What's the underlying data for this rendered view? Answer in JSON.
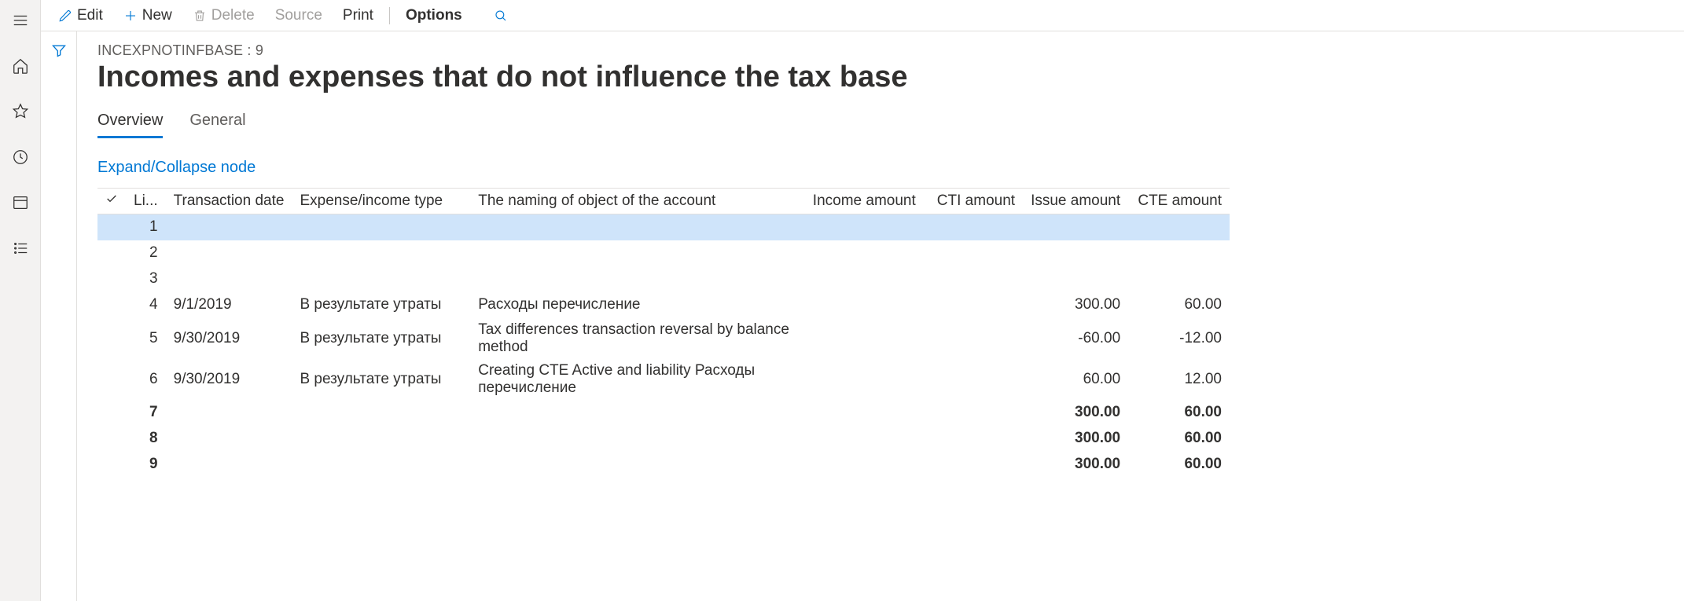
{
  "toolbar": {
    "edit": "Edit",
    "new": "New",
    "delete": "Delete",
    "source": "Source",
    "print": "Print",
    "options": "Options"
  },
  "page": {
    "subhead": "INCEXPNOTINFBASE : 9",
    "title": "Incomes and expenses that do not influence the tax base"
  },
  "tabs": {
    "overview": "Overview",
    "general": "General"
  },
  "links": {
    "expand": "Expand/Collapse node"
  },
  "grid": {
    "headers": {
      "line": "Li...",
      "date": "Transaction date",
      "type": "Expense/income type",
      "object": "The naming of object of the account",
      "income": "Income amount",
      "cti": "CTI amount",
      "issue": "Issue amount",
      "cte": "CTE amount"
    },
    "rows": [
      {
        "line": "1",
        "date": "",
        "type": "",
        "object": "",
        "income": "",
        "cti": "",
        "issue": "",
        "cte": "",
        "selected": true
      },
      {
        "line": "2",
        "date": "",
        "type": "",
        "object": "",
        "income": "",
        "cti": "",
        "issue": "",
        "cte": ""
      },
      {
        "line": "3",
        "date": "",
        "type": "",
        "object": "",
        "income": "",
        "cti": "",
        "issue": "",
        "cte": ""
      },
      {
        "line": "4",
        "date": "9/1/2019",
        "type": "В результате утраты",
        "object": "Расходы перечисление",
        "income": "",
        "cti": "",
        "issue": "300.00",
        "cte": "60.00"
      },
      {
        "line": "5",
        "date": "9/30/2019",
        "type": "В результате утраты",
        "object": "Tax differences transaction reversal by balance method",
        "income": "",
        "cti": "",
        "issue": "-60.00",
        "cte": "-12.00"
      },
      {
        "line": "6",
        "date": "9/30/2019",
        "type": "В результате утраты",
        "object": "Creating CTE Active and liability Расходы перечисление",
        "income": "",
        "cti": "",
        "issue": "60.00",
        "cte": "12.00"
      },
      {
        "line": "7",
        "date": "",
        "type": "",
        "object": "",
        "income": "",
        "cti": "",
        "issue": "300.00",
        "cte": "60.00",
        "totals": true
      },
      {
        "line": "8",
        "date": "",
        "type": "",
        "object": "",
        "income": "",
        "cti": "",
        "issue": "300.00",
        "cte": "60.00",
        "totals": true
      },
      {
        "line": "9",
        "date": "",
        "type": "",
        "object": "",
        "income": "",
        "cti": "",
        "issue": "300.00",
        "cte": "60.00",
        "totals": true
      }
    ]
  }
}
